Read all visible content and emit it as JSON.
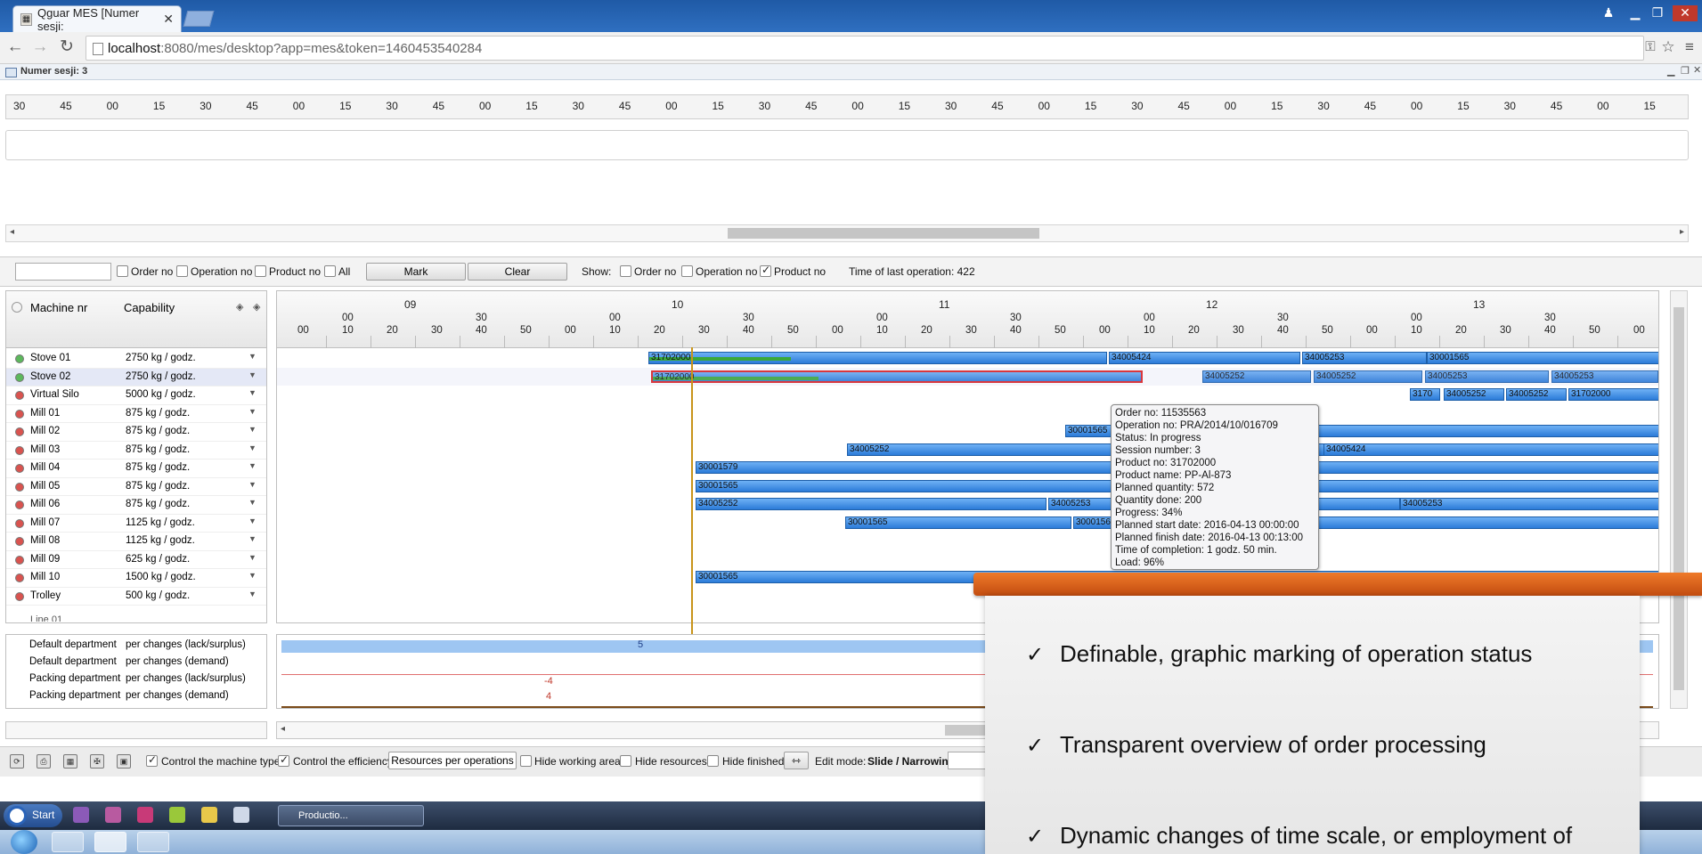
{
  "browser": {
    "tab_title": "Qguar MES [Numer sesji:",
    "url_host": "localhost",
    "url_rest": ":8080/mes/desktop?app=mes&token=1460453540284"
  },
  "session": {
    "label": "Numer sesji: 3"
  },
  "top_scale": [
    "30",
    "45",
    "00",
    "15",
    "30",
    "45",
    "00",
    "15",
    "30",
    "45",
    "00",
    "15",
    "30",
    "45",
    "00",
    "15",
    "30",
    "45",
    "00",
    "15",
    "30",
    "45",
    "00",
    "15",
    "30",
    "45",
    "00",
    "15",
    "30",
    "45",
    "00",
    "15",
    "30",
    "45",
    "00",
    "15"
  ],
  "filter_bar": {
    "search_value": "",
    "order_no": "Order no",
    "operation_no": "Operation no",
    "product_no": "Product no",
    "all": "All",
    "mark_button": "Mark",
    "clear_button": "Clear",
    "show_label": "Show:",
    "show_order_no": "Order no",
    "show_operation_no": "Operation no",
    "show_product_no": "Product no",
    "last_operation": "Time of last operation: 422"
  },
  "machine_table": {
    "col_machine": "Machine nr",
    "col_capability": "Capability",
    "rows": [
      {
        "name": "Stove 01",
        "cap": "2750 kg / godz.",
        "status": "#5cb85c"
      },
      {
        "name": "Stove 02",
        "cap": "2750 kg / godz.",
        "status": "#5cb85c"
      },
      {
        "name": "Virtual Silo",
        "cap": "5000 kg / godz.",
        "status": "#d9534f"
      },
      {
        "name": "Mill 01",
        "cap": "875 kg / godz.",
        "status": "#d9534f"
      },
      {
        "name": "Mill 02",
        "cap": "875 kg / godz.",
        "status": "#d9534f"
      },
      {
        "name": "Mill 03",
        "cap": "875 kg / godz.",
        "status": "#d9534f"
      },
      {
        "name": "Mill 04",
        "cap": "875 kg / godz.",
        "status": "#d9534f"
      },
      {
        "name": "Mill 05",
        "cap": "875 kg / godz.",
        "status": "#d9534f"
      },
      {
        "name": "Mill 06",
        "cap": "875 kg / godz.",
        "status": "#d9534f"
      },
      {
        "name": "Mill 07",
        "cap": "1125 kg / godz.",
        "status": "#d9534f"
      },
      {
        "name": "Mill 08",
        "cap": "1125 kg / godz.",
        "status": "#d9534f"
      },
      {
        "name": "Mill 09",
        "cap": "625 kg / godz.",
        "status": "#d9534f"
      },
      {
        "name": "Mill 10",
        "cap": "1500 kg / godz.",
        "status": "#d9534f"
      },
      {
        "name": "Trolley",
        "cap": "500 kg / godz.",
        "status": "#d9534f"
      }
    ]
  },
  "gantt_header": {
    "hours": [
      "09",
      "10",
      "11",
      "12",
      "13"
    ],
    "minutes": [
      "00",
      "10",
      "20",
      "30",
      "40",
      "50",
      "00",
      "10",
      "20",
      "30",
      "40",
      "50",
      "00",
      "10",
      "20",
      "30",
      "40",
      "50",
      "00",
      "10",
      "20",
      "30",
      "40",
      "50",
      "00",
      "10",
      "20",
      "30",
      "40",
      "50",
      "00"
    ],
    "half": [
      "00",
      "30",
      "00",
      "30",
      "00",
      "30",
      "00",
      "30",
      "00",
      "30"
    ]
  },
  "gantt_bars": [
    {
      "row": 0,
      "label": "31702000",
      "progress": 0.31
    },
    {
      "row": 0,
      "label": "34005424"
    },
    {
      "row": 0,
      "label": "34005253"
    },
    {
      "row": 0,
      "label": "30001565"
    },
    {
      "row": 1,
      "label": "31702000",
      "progress": 0.34,
      "selected": true
    },
    {
      "row": 1,
      "label": "34005252"
    },
    {
      "row": 1,
      "label": "34005252"
    },
    {
      "row": 1,
      "label": "34005253"
    },
    {
      "row": 1,
      "label": "34005253"
    },
    {
      "row": 2,
      "label": "3170"
    },
    {
      "row": 2,
      "label": "34005252"
    },
    {
      "row": 2,
      "label": "34005252"
    },
    {
      "row": 2,
      "label": "31702000"
    },
    {
      "row": 4,
      "label": "30001565"
    },
    {
      "row": 5,
      "label": "34005252"
    },
    {
      "row": 5,
      "label": "34005424"
    },
    {
      "row": 6,
      "label": "30001579"
    },
    {
      "row": 7,
      "label": "30001565"
    },
    {
      "row": 8,
      "label": "34005252"
    },
    {
      "row": 8,
      "label": "34005253"
    },
    {
      "row": 8,
      "label": "34005253"
    },
    {
      "row": 9,
      "label": "30001565"
    },
    {
      "row": 9,
      "label": "3000156"
    },
    {
      "row": 12,
      "label": "30001565"
    }
  ],
  "tooltip": [
    "Order no: 11535563",
    "Operation no: PRA/2014/10/016709",
    "Status: In progress",
    "Session number: 3",
    "Product no: 31702000",
    "Product name: PP-Al-873",
    "Planned quantity: 572",
    "Quantity done: 200",
    "Progress: 34%",
    "Planned start date: 2016-04-13 00:00:00",
    "Planned finish date: 2016-04-13 00:13:00",
    "Time of completion: 1 godz. 50 min.",
    "Load: 96%"
  ],
  "departments": [
    {
      "name": "Default department",
      "change": "per changes (lack/surplus)"
    },
    {
      "name": "Default department",
      "change": "per changes (demand)"
    },
    {
      "name": "Packing department",
      "change": "per changes (lack/surplus)"
    },
    {
      "name": "Packing department",
      "change": "per changes (demand)"
    }
  ],
  "dept_values": {
    "surplus_default": "5",
    "surplus_packing": "-4",
    "demand_packing": "4"
  },
  "bottom_toolbar": {
    "control_machine_type": "Control the machine type",
    "control_efficiency": "Control the efficiency",
    "resources_select": "Resources per operations",
    "hide_working_area": "Hide working area",
    "hide_resources": "Hide resources",
    "hide_finished": "Hide finished",
    "edit_mode_label": "Edit mode:",
    "edit_mode_value": "Slide / Narrowing"
  },
  "taskbar": {
    "start": "Start",
    "task_item": "Productio..."
  },
  "overlay": {
    "features": [
      "Definable, graphic marking of operation status",
      "Transparent overview of order processing",
      "Dynamic changes of time scale, or employment of"
    ]
  }
}
